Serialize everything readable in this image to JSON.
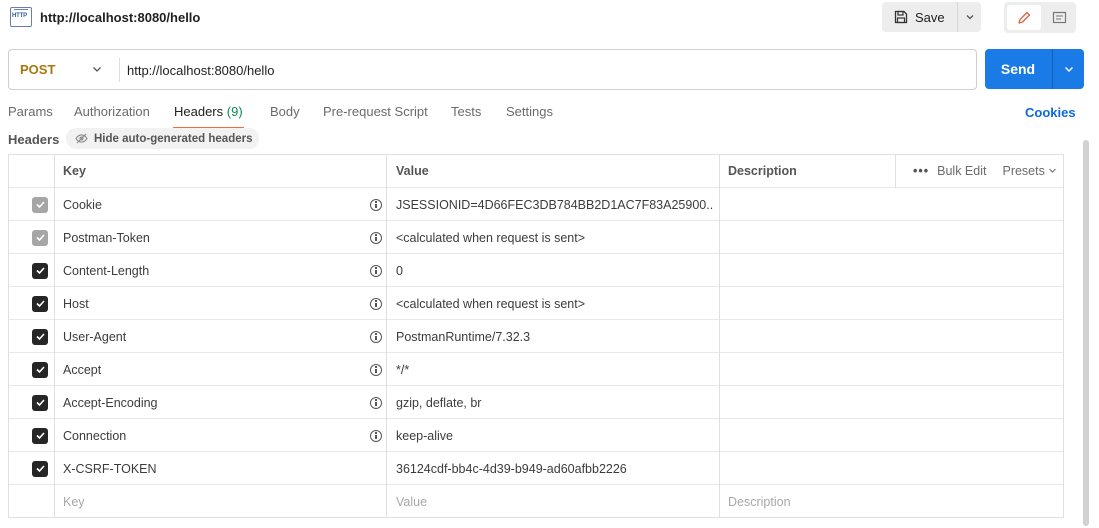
{
  "tab_title": "http://localhost:8080/hello",
  "toolbar": {
    "save_label": "Save"
  },
  "request": {
    "method": "POST",
    "url": "http://localhost:8080/hello",
    "send_label": "Send"
  },
  "tabs": [
    {
      "label": "Params"
    },
    {
      "label": "Authorization"
    },
    {
      "label": "Headers",
      "count": "(9)",
      "active": true
    },
    {
      "label": "Body"
    },
    {
      "label": "Pre-request Script"
    },
    {
      "label": "Tests"
    },
    {
      "label": "Settings"
    }
  ],
  "cookies_label": "Cookies",
  "headers_section": {
    "label": "Headers",
    "hide_label": "Hide auto-generated headers"
  },
  "table": {
    "columns": {
      "key": "Key",
      "value": "Value",
      "description": "Description"
    },
    "bulk_edit": "Bulk Edit",
    "presets": "Presets",
    "rows": [
      {
        "key": "Cookie",
        "value": "JSESSIONID=4D66FEC3DB784BB2D1AC7F83A25900...",
        "checked": true,
        "disabled": true,
        "info": true
      },
      {
        "key": "Postman-Token",
        "value": "<calculated when request is sent>",
        "checked": true,
        "disabled": true,
        "info": true
      },
      {
        "key": "Content-Length",
        "value": "0",
        "checked": true,
        "disabled": false,
        "info": true
      },
      {
        "key": "Host",
        "value": "<calculated when request is sent>",
        "checked": true,
        "disabled": false,
        "info": true
      },
      {
        "key": "User-Agent",
        "value": "PostmanRuntime/7.32.3",
        "checked": true,
        "disabled": false,
        "info": true
      },
      {
        "key": "Accept",
        "value": "*/*",
        "checked": true,
        "disabled": false,
        "info": true
      },
      {
        "key": "Accept-Encoding",
        "value": "gzip, deflate, br",
        "checked": true,
        "disabled": false,
        "info": true
      },
      {
        "key": "Connection",
        "value": "keep-alive",
        "checked": true,
        "disabled": false,
        "info": true
      },
      {
        "key": "X-CSRF-TOKEN",
        "value": "36124cdf-bb4c-4d39-b949-ad60afbb2226",
        "checked": true,
        "disabled": false,
        "info": false
      }
    ],
    "placeholder": {
      "key": "Key",
      "value": "Value",
      "description": "Description"
    }
  },
  "colors": {
    "method": "#a9760d",
    "send": "#1a7ae6",
    "active_tab_underline": "#f26b3a",
    "count": "#0c8a4e",
    "link": "#0d6ad8"
  }
}
